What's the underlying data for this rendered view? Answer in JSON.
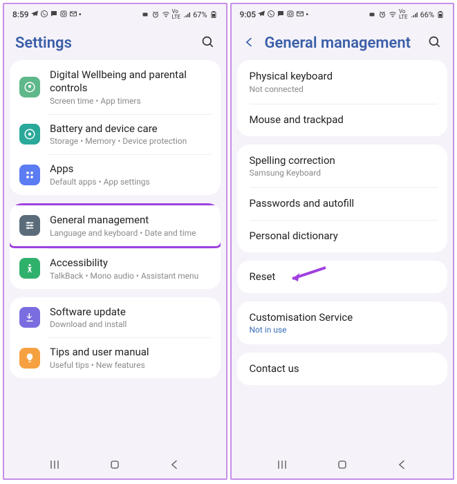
{
  "left": {
    "status": {
      "time": "8:59",
      "battery": "67%"
    },
    "header": {
      "title": "Settings"
    },
    "groups": [
      {
        "items": [
          {
            "icon": "wellbeing",
            "color": "#5fb88a",
            "title": "Digital Wellbeing and parental controls",
            "sub": "Screen time  •  App timers"
          },
          {
            "icon": "battery",
            "color": "#2aa99a",
            "title": "Battery and device care",
            "sub": "Storage  •  Memory  •  Device protection"
          },
          {
            "icon": "apps",
            "color": "#5b7cf2",
            "title": "Apps",
            "sub": "Default apps  •  App settings"
          }
        ]
      },
      {
        "items": [
          {
            "icon": "sliders",
            "color": "#5a6c7a",
            "title": "General management",
            "sub": "Language and keyboard  •  Date and time",
            "highlight": true
          },
          {
            "icon": "access",
            "color": "#2fb16c",
            "title": "Accessibility",
            "sub": "TalkBack  •  Mono audio  •  Assistant menu"
          }
        ]
      },
      {
        "items": [
          {
            "icon": "update",
            "color": "#7a6de0",
            "title": "Software update",
            "sub": "Download and install"
          },
          {
            "icon": "tips",
            "color": "#f5a142",
            "title": "Tips and user manual",
            "sub": "Useful tips  •  New features"
          }
        ]
      }
    ]
  },
  "right": {
    "status": {
      "time": "9:05",
      "battery": "66%"
    },
    "header": {
      "title": "General management"
    },
    "groups": [
      {
        "items": [
          {
            "title": "Physical keyboard",
            "sub": "Not connected"
          },
          {
            "title": "Mouse and trackpad"
          }
        ]
      },
      {
        "items": [
          {
            "title": "Spelling correction",
            "sub": "Samsung Keyboard"
          },
          {
            "title": "Passwords and autofill"
          },
          {
            "title": "Personal dictionary"
          }
        ]
      },
      {
        "items": [
          {
            "title": "Reset",
            "arrow": true
          }
        ]
      },
      {
        "items": [
          {
            "title": "Customisation Service",
            "sub": "Not in use",
            "subBlue": true
          }
        ]
      },
      {
        "items": [
          {
            "title": "Contact us"
          }
        ]
      }
    ]
  }
}
